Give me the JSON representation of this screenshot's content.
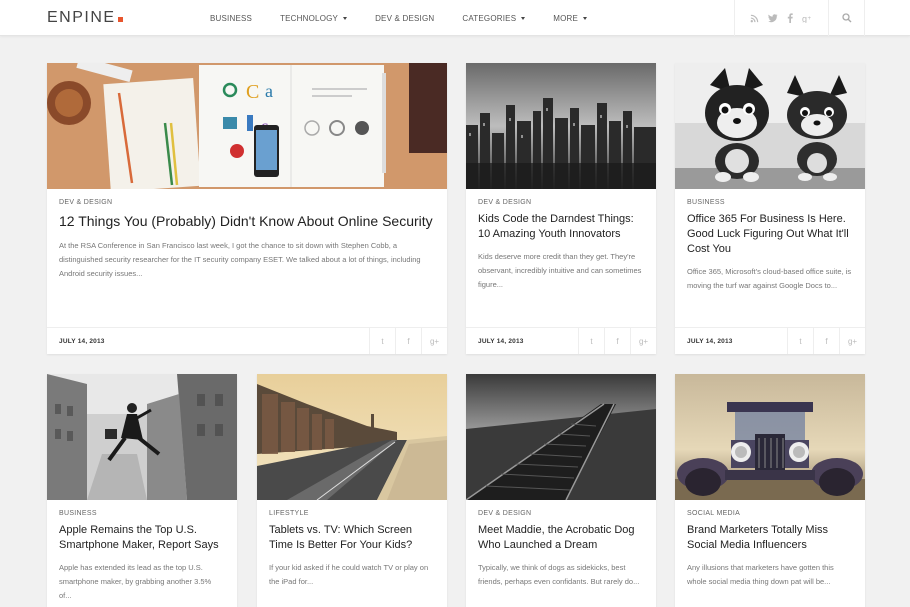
{
  "header": {
    "logo_text": "ENPINE",
    "nav": [
      {
        "label": "BUSINESS"
      },
      {
        "label": "TECHNOLOGY"
      },
      {
        "label": "DEV & DESIGN"
      },
      {
        "label": "CATEGORIES"
      },
      {
        "label": "MORE"
      }
    ],
    "social_icons": [
      "rss-icon",
      "twitter-icon",
      "facebook-icon",
      "google-plus-icon"
    ],
    "search_icon": "search-icon",
    "accent": "#e8552d"
  },
  "posts": [
    {
      "category": "DEV & DESIGN",
      "title": "12 Things You (Probably) Didn't Know About Online Security",
      "excerpt": "At the RSA Conference in San Francisco last week, I got the chance to sit down with Stephen Cobb, a distinguished security researcher for the IT security company ESET. We talked about a lot of things, including Android security issues...",
      "date": "JULY 14, 2013"
    },
    {
      "category": "DEV & DESIGN",
      "title": "Kids Code the Darndest Things: 10 Amazing Youth Innovators",
      "excerpt": "Kids deserve more credit than they get. They're observant, incredibly intuitive and can sometimes figure...",
      "date": "JULY 14, 2013"
    },
    {
      "category": "BUSINESS",
      "title": "Office 365 For Business Is Here. Good Luck Figuring Out What It'll Cost You",
      "excerpt": "Office 365, Microsoft's cloud-based office suite, is moving the turf war against Google Docs to...",
      "date": "JULY 14, 2013"
    },
    {
      "category": "BUSINESS",
      "title": "Apple Remains the Top U.S. Smartphone Maker, Report Says",
      "excerpt": "Apple has extended its lead as the top U.S. smartphone maker, by grabbing another 3.5% of..."
    },
    {
      "category": "LIFESTYLE",
      "title": "Tablets vs. TV: Which Screen Time Is Better For Your Kids?",
      "excerpt": "If your kid asked if he could watch TV or play on the iPad for..."
    },
    {
      "category": "DEV & DESIGN",
      "title": "Meet Maddie, the Acrobatic Dog Who Launched a Dream",
      "excerpt": "Typically, we think of dogs as sidekicks, best friends, perhaps even confidants. But rarely do..."
    },
    {
      "category": "SOCIAL MEDIA",
      "title": "Brand Marketers Totally Miss Social Media Influencers",
      "excerpt": "Any illusions that marketers have gotten this whole social media thing down pat will be..."
    }
  ],
  "share_icons": [
    "twitter-icon",
    "facebook-icon",
    "google-plus-icon"
  ]
}
